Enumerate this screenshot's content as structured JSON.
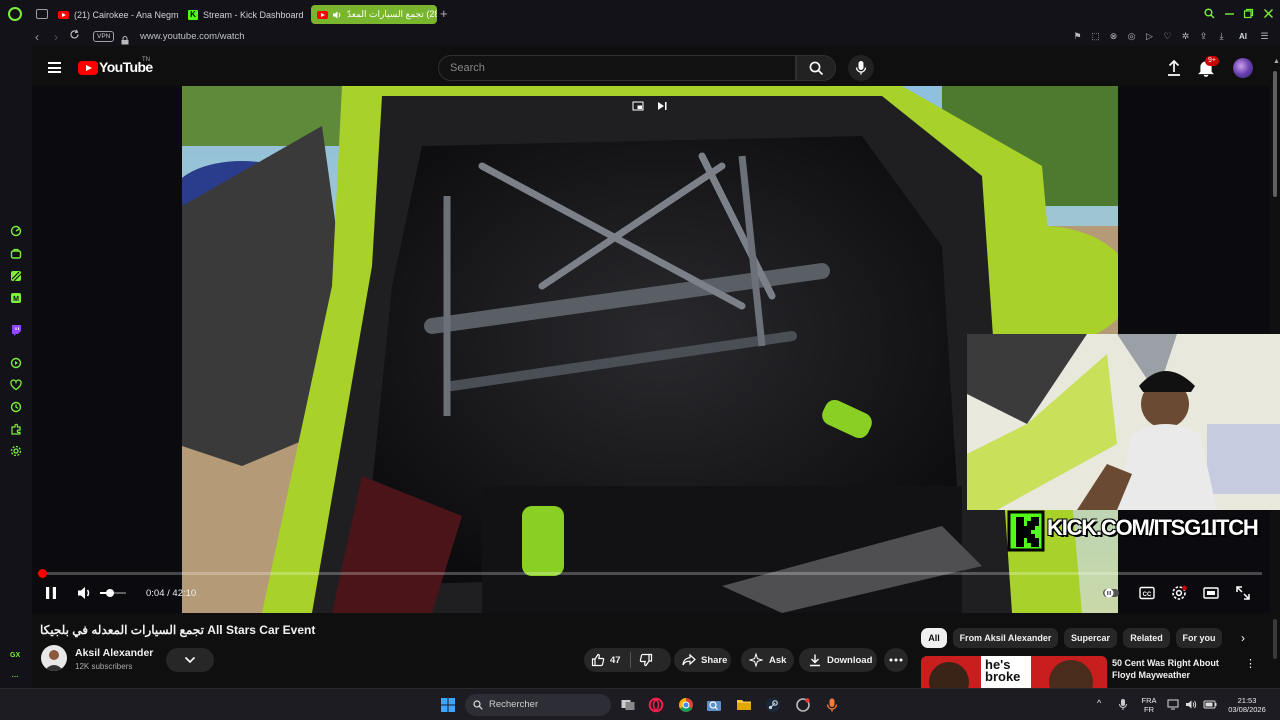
{
  "browser": {
    "tabs": [
      {
        "label": "(21) Cairokee - Ana Negm",
        "favicon": "youtube"
      },
      {
        "label": "Stream - Kick Dashboard",
        "favicon": "kick"
      },
      {
        "label": "(28) تجمع السيارات المعدّ",
        "favicon": "youtube",
        "active": true
      }
    ],
    "url": "www.youtube.com/watch",
    "vpn_label": "VPN",
    "ai_label": "AI",
    "gx_label": "GX",
    "accent_color": "#7cf03a"
  },
  "youtube": {
    "logo_text": "YouTube",
    "region_label": "TN",
    "search_placeholder": "Search",
    "notifications_badge": "9+",
    "player": {
      "current_time": "0:04",
      "duration": "42:10",
      "time_display": "0:04 / 42:10",
      "progress_fraction": 0.0016,
      "volume_fraction": 0.4,
      "overlay_kick_text": "KICK.COM/ITSG1ITCH"
    },
    "video": {
      "title": "تجمع السيارات المعدله في بلجيكا All Stars Car Event",
      "channel_name": "Aksil Alexander",
      "subscribers": "12K subscribers",
      "like_count": "47",
      "share_label": "Share",
      "ask_label": "Ask",
      "download_label": "Download"
    },
    "chips": [
      "All",
      "From Aksil Alexander",
      "Supercar",
      "Related",
      "For you"
    ],
    "recommendation": {
      "title": "50 Cent Was Right About Floyd Mayweather",
      "thumb_text": "he's broke"
    }
  },
  "taskbar": {
    "search_label": "Rechercher",
    "lang_top": "FRA",
    "lang_bottom": "FR",
    "time": "21:53",
    "date": "03/08/2026"
  }
}
